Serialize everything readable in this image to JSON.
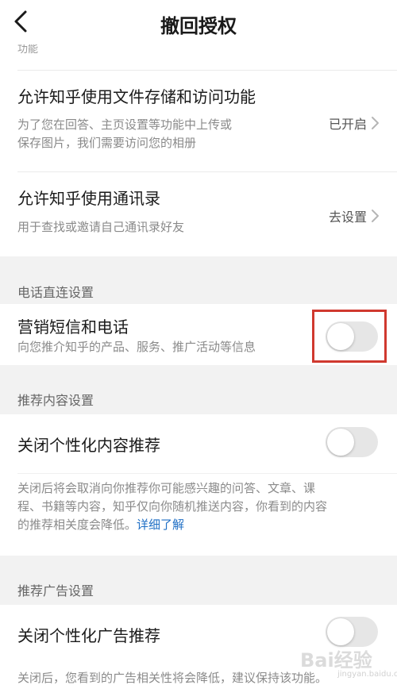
{
  "header": {
    "title": "撤回授权"
  },
  "partial_text": "功能",
  "permissions": [
    {
      "title": "允许知乎使用文件存储和访问功能",
      "desc_line1": "为了您在回答、主页设置等功能中上传或",
      "desc_line2": "保存图片，我们需要访问您的相册",
      "status": "已开启"
    },
    {
      "title": "允许知乎使用通讯录",
      "desc_line1": "用于查找或邀请自己通讯录好友",
      "status": "去设置"
    }
  ],
  "phone_section": {
    "label": "电话直连设置",
    "item": {
      "title": "营销短信和电话",
      "desc": "向您推介知乎的产品、服务、推广活动等信息",
      "enabled": false
    }
  },
  "content_section": {
    "label": "推荐内容设置",
    "item": {
      "title": "关闭个性化内容推荐",
      "enabled": false
    },
    "note_line1": "关闭后将会取消向你推荐你可能感兴趣的问答、文章、课",
    "note_line2": "程、书籍等内容，知乎仅向你随机推送内容，你看到的内容",
    "note_line3": "的推荐相关度会降低。",
    "note_link": "详细了解"
  },
  "ad_section": {
    "label": "推荐广告设置",
    "item": {
      "title": "关闭个性化广告推荐",
      "enabled": false
    },
    "note": "关闭后，您看到的广告相关性将会降低，建议保持该功能。"
  },
  "watermark": {
    "main": "Bai经验",
    "sub": "jingyan.baidu.com"
  },
  "colors": {
    "highlight": "#d0392f",
    "link": "#1f6fc5",
    "toggle_off": "#e6e6e6",
    "section_bg": "#f2f2f2"
  },
  "icons": {
    "back": "chevron-left-icon",
    "row_arrow": "chevron-right-icon"
  }
}
